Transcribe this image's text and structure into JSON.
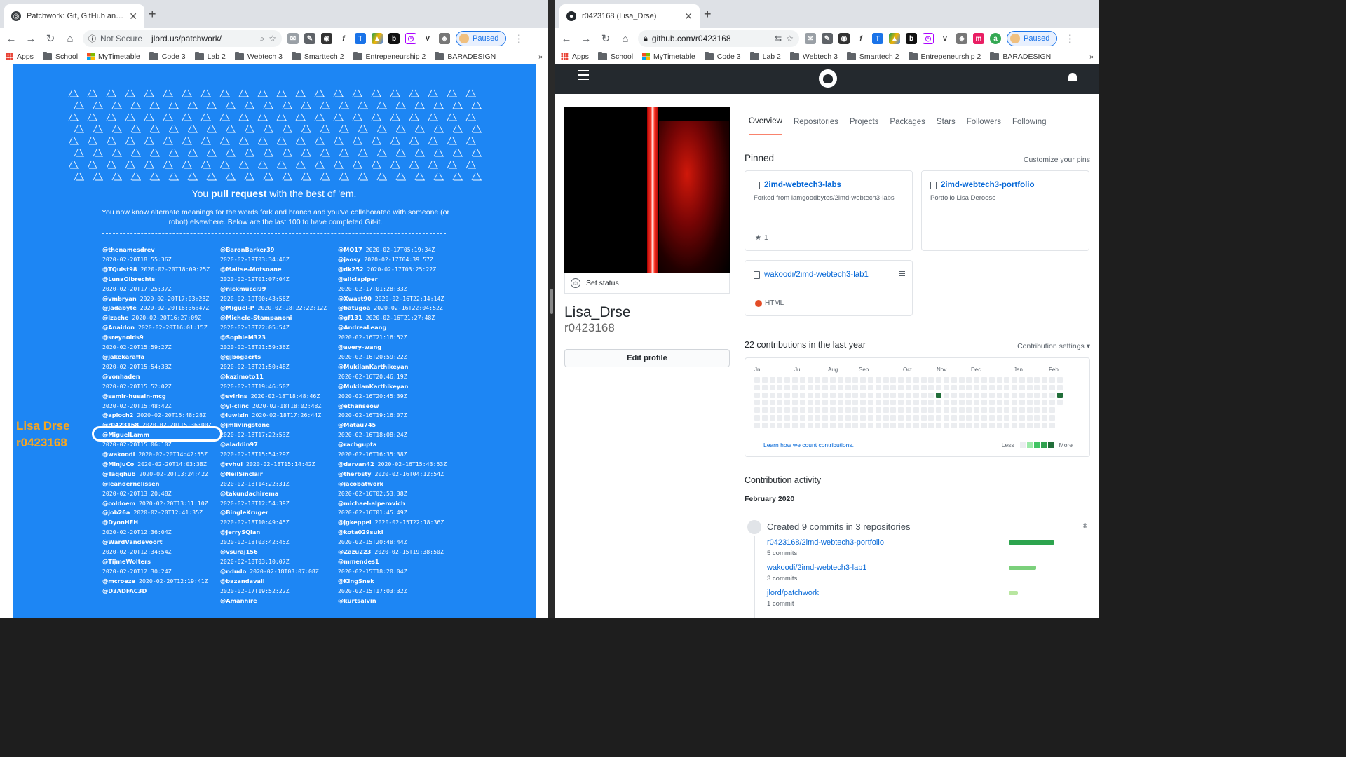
{
  "left": {
    "tab_title": "Patchwork: Git, GitHub and the P",
    "url_warning": "Not Secure",
    "url": "jlord.us/patchwork/",
    "paused": "Paused",
    "bookmarks": [
      "Apps",
      "School",
      "MyTimetable",
      "Code 3",
      "Lab 2",
      "Webtech 3",
      "Smarttech 2",
      "Entrepeneurship 2",
      "BARADESIGN"
    ],
    "headline_pre": "You ",
    "headline_bold": "pull request",
    "headline_post": " with the best of 'em.",
    "sub_text": "You now know alternate meanings for the words fork and branch and you've collaborated with someone (or robot) elsewhere. Below are the last 100 to have completed Git-it.",
    "annotation_name": "Lisa Drse",
    "annotation_id": "r0423168",
    "users_col1": [
      [
        "@thenamesdrev",
        "2020-02-20T18:55:36Z",
        "wrap"
      ],
      [
        "@TQuist98",
        "2020-02-20T18:09:25Z",
        "inline"
      ],
      [
        "@LunaOlbrechts",
        "2020-02-20T17:25:37Z",
        "wrap"
      ],
      [
        "@vmbryan",
        "2020-02-20T17:03:28Z",
        "inline"
      ],
      [
        "@Jadabyte",
        "2020-02-20T16:36:47Z",
        "inline"
      ],
      [
        "@lzache",
        "2020-02-20T16:27:09Z",
        "inline"
      ],
      [
        "@Anaidon",
        "2020-02-20T16:01:15Z",
        "inline"
      ],
      [
        "@sreynolds9",
        "2020-02-20T15:59:27Z",
        "wrap"
      ],
      [
        "@jakekaraffa",
        "2020-02-20T15:54:33Z",
        "wrap"
      ],
      [
        "@vonhaden",
        "2020-02-20T15:52:02Z",
        "wrap"
      ],
      [
        "@samir-husain-mcg",
        "2020-02-20T15:48:42Z",
        "wrap"
      ],
      [
        "@aploch2",
        "2020-02-20T15:48:28Z",
        "inline"
      ],
      [
        "@r0423168",
        "2020-02-20T15:36:00Z",
        "inline"
      ],
      [
        "@MiguelLamm",
        "2020-02-20T15:06:10Z",
        "wrap"
      ],
      [
        "@wakoodi",
        "2020-02-20T14:42:55Z",
        "inline"
      ],
      [
        "@MinjuCo",
        "2020-02-20T14:03:38Z",
        "inline"
      ],
      [
        "@Taqqhub",
        "2020-02-20T13:24:42Z",
        "inline"
      ],
      [
        "@leandernelissen",
        "2020-02-20T13:20:48Z",
        "wrap"
      ],
      [
        "@coldoem",
        "2020-02-20T13:11:10Z",
        "inline"
      ],
      [
        "@job26a",
        "2020-02-20T12:41:35Z",
        "inline"
      ],
      [
        "@DyonHEH",
        "2020-02-20T12:36:04Z",
        "wrap"
      ],
      [
        "@WardVandevoort",
        "2020-02-20T12:34:54Z",
        "wrap"
      ],
      [
        "@TijmeWolters",
        "2020-02-20T12:30:24Z",
        "wrap"
      ],
      [
        "@mcroeze",
        "2020-02-20T12:19:41Z",
        "inline"
      ],
      [
        "@D3ADFAC3D",
        "",
        "wrap"
      ]
    ],
    "users_col2": [
      [
        "@BaronBarker39",
        "2020-02-19T03:34:46Z",
        "wrap"
      ],
      [
        "@Maitse-Motsoane",
        "2020-02-19T01:07:04Z",
        "wrap"
      ],
      [
        "@nickmucci99",
        "2020-02-19T00:43:56Z",
        "wrap"
      ],
      [
        "@Miguel-P",
        "2020-02-18T22:22:12Z",
        "inline"
      ],
      [
        "@Michele-Stampanoni",
        "2020-02-18T22:05:54Z",
        "wrap"
      ],
      [
        "@SophieM323",
        "2020-02-18T21:59:36Z",
        "wrap"
      ],
      [
        "@gjbogaerts",
        "2020-02-18T21:50:48Z",
        "wrap"
      ],
      [
        "@kazimoto11",
        "2020-02-18T19:46:50Z",
        "wrap"
      ],
      [
        "@svirins",
        "2020-02-18T18:48:46Z",
        "inline"
      ],
      [
        "@yl-clinc",
        "2020-02-18T18:02:48Z",
        "inline"
      ],
      [
        "@luwizin",
        "2020-02-18T17:26:44Z",
        "inline"
      ],
      [
        "@jmlivingstone",
        "2020-02-18T17:22:53Z",
        "wrap"
      ],
      [
        "@aladdin97",
        "2020-02-18T15:54:29Z",
        "wrap"
      ],
      [
        "@rvhui",
        "2020-02-18T15:14:42Z",
        "inline"
      ],
      [
        "@NeilSinclair",
        "2020-02-18T14:22:31Z",
        "wrap"
      ],
      [
        "@takundachirema",
        "2020-02-18T12:54:39Z",
        "wrap"
      ],
      [
        "@BingleKruger",
        "2020-02-18T10:49:45Z",
        "wrap"
      ],
      [
        "@JerrySQian",
        "2020-02-18T03:42:45Z",
        "wrap"
      ],
      [
        "@vsuraj156",
        "2020-02-18T03:10:07Z",
        "wrap"
      ],
      [
        "@ndudo",
        "2020-02-18T03:07:08Z",
        "inline"
      ],
      [
        "@bazandavail",
        "2020-02-17T19:52:22Z",
        "wrap"
      ],
      [
        "@Amanhire",
        "",
        "wrap"
      ]
    ],
    "users_col3": [
      [
        "@MQ17",
        "2020-02-17T05:19:34Z",
        "inline"
      ],
      [
        "@jaosy",
        "2020-02-17T04:39:57Z",
        "inline"
      ],
      [
        "@dk252",
        "2020-02-17T03:25:22Z",
        "inline"
      ],
      [
        "@aliciapiper",
        "2020-02-17T01:28:33Z",
        "wrap"
      ],
      [
        "@Xwast90",
        "2020-02-16T22:14:14Z",
        "inline"
      ],
      [
        "@batugoa",
        "2020-02-16T22:04:52Z",
        "inline"
      ],
      [
        "@gf131",
        "2020-02-16T21:27:48Z",
        "inline"
      ],
      [
        "@AndreaLeang",
        "2020-02-16T21:16:52Z",
        "wrap"
      ],
      [
        "@avery-wang",
        "2020-02-16T20:59:22Z",
        "wrap"
      ],
      [
        "@MukilanKarthikeyan",
        "2020-02-16T20:46:19Z",
        "wrap"
      ],
      [
        "@MukilanKarthikeyan",
        "2020-02-16T20:45:39Z",
        "wrap"
      ],
      [
        "@ethanseow",
        "2020-02-16T19:16:07Z",
        "wrap"
      ],
      [
        "@Matau745",
        "2020-02-16T18:08:24Z",
        "wrap"
      ],
      [
        "@rachgupta",
        "2020-02-16T16:35:38Z",
        "wrap"
      ],
      [
        "@darvan42",
        "2020-02-16T15:43:53Z",
        "inline"
      ],
      [
        "@therbsty",
        "2020-02-16T04:12:54Z",
        "inline"
      ],
      [
        "@jacobatwork",
        "2020-02-16T02:53:38Z",
        "wrap"
      ],
      [
        "@michael-alperovich",
        "2020-02-16T01:45:49Z",
        "wrap"
      ],
      [
        "@jgkeppel",
        "2020-02-15T22:18:36Z",
        "inline"
      ],
      [
        "@kota029suki",
        "2020-02-15T20:48:44Z",
        "wrap"
      ],
      [
        "@Zazu223",
        "2020-02-15T19:38:50Z",
        "inline"
      ],
      [
        "@mmendes1",
        "2020-02-15T18:20:04Z",
        "wrap"
      ],
      [
        "@KingSnek",
        "2020-02-15T17:03:32Z",
        "wrap"
      ],
      [
        "@kurtsalvin",
        "",
        "wrap"
      ]
    ]
  },
  "right": {
    "tab_title": "r0423168 (Lisa_Drse)",
    "url": "github.com/r0423168",
    "paused": "Paused",
    "bookmarks": [
      "Apps",
      "School",
      "MyTimetable",
      "Code 3",
      "Lab 2",
      "Webtech 3",
      "Smarttech 2",
      "Entrepeneurship 2",
      "BARADESIGN"
    ],
    "set_status": "Set status",
    "profile_name": "Lisa_Drse",
    "profile_login": "r0423168",
    "edit_profile": "Edit profile",
    "nav_tabs": [
      "Overview",
      "Repositories",
      "Projects",
      "Packages",
      "Stars",
      "Followers",
      "Following"
    ],
    "pinned_title": "Pinned",
    "customize_pins": "Customize your pins",
    "pins": [
      {
        "repo": "2imd-webtech3-labs",
        "desc": "Forked from iamgoodbytes/2imd-webtech3-labs",
        "meta": "1",
        "meta_type": "star"
      },
      {
        "repo": "2imd-webtech3-portfolio",
        "desc": "Portfolio Lisa Deroose",
        "meta": "",
        "meta_type": "none"
      },
      {
        "repo": "wakoodi/2imd-webtech3-lab1",
        "desc": "",
        "meta": "HTML",
        "meta_type": "lang"
      }
    ],
    "contrib_title": "22 contributions in the last year",
    "contrib_settings": "Contribution settings",
    "months": [
      "Jn",
      "Jul",
      "Aug",
      "Sep",
      "Oct",
      "Nov",
      "Dec",
      "Jan",
      "Feb"
    ],
    "learn_link": "Learn how we count contributions.",
    "legend_less": "Less",
    "legend_more": "More",
    "activity_title": "Contribution activity",
    "activity_month": "February 2020",
    "activity_summary": "Created 9 commits in 3 repositories",
    "activity_rows": [
      {
        "repo": "r0423168/2imd-webtech3-portfolio",
        "commits": "5 commits",
        "count": 5
      },
      {
        "repo": "wakoodi/2imd-webtech3-lab1",
        "commits": "3 commits",
        "count": 3
      },
      {
        "repo": "jlord/patchwork",
        "commits": "1 commit",
        "count": 1
      }
    ]
  }
}
